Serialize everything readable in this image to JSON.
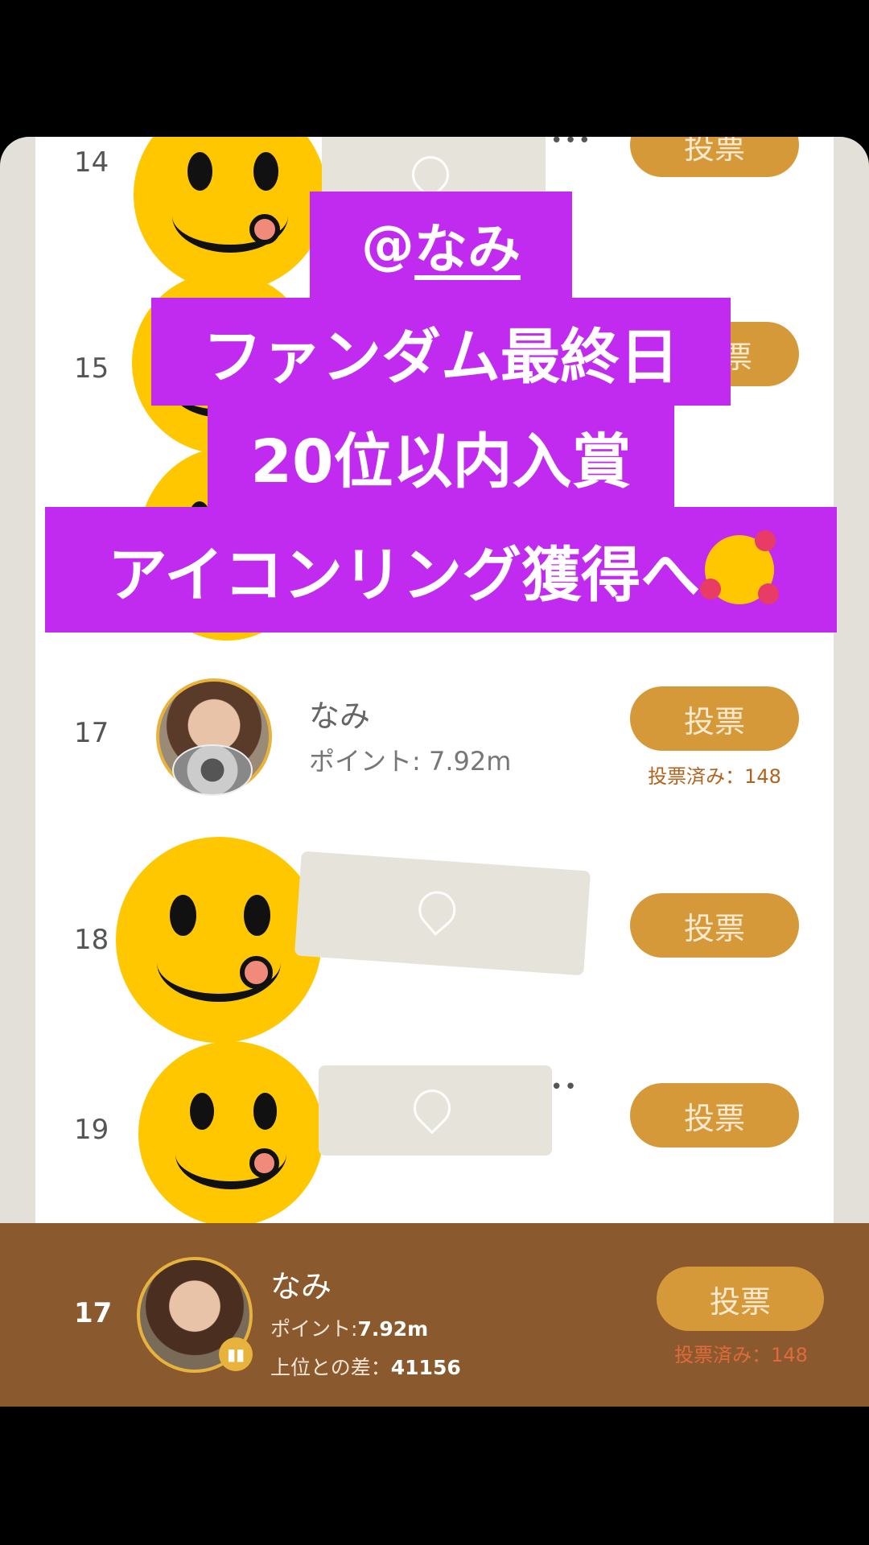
{
  "leaderboard": {
    "rows": [
      {
        "rank": "14",
        "vote_label": "投票"
      },
      {
        "rank": "15",
        "vote_label": "票"
      },
      {
        "rank": "17",
        "vote_label": "投票",
        "name": "なみ",
        "points": "ポイント: 7.92m",
        "voted": "投票済み：148"
      },
      {
        "rank": "18",
        "vote_label": "投票"
      },
      {
        "rank": "19",
        "vote_label": "投票"
      }
    ]
  },
  "overlay": {
    "line1_at": "@",
    "line1_name": "なみ",
    "line2": "ファンダム最終日",
    "line3": "20位以内入賞",
    "line4": "アイコンリング獲得へ",
    "emoji": "smiling-face-with-hearts-icon"
  },
  "current_user": {
    "rank": "17",
    "name": "なみ",
    "points_label": "ポイント:",
    "points_value": "7.92m",
    "diff_label": "上位との差：",
    "diff_value": "41156",
    "vote_label": "投票",
    "voted": "投票済み：148"
  },
  "colors": {
    "vote_button": "#d5993a",
    "overlay_purple": "#c02bef",
    "bottom_bar": "#8a5a2e"
  }
}
